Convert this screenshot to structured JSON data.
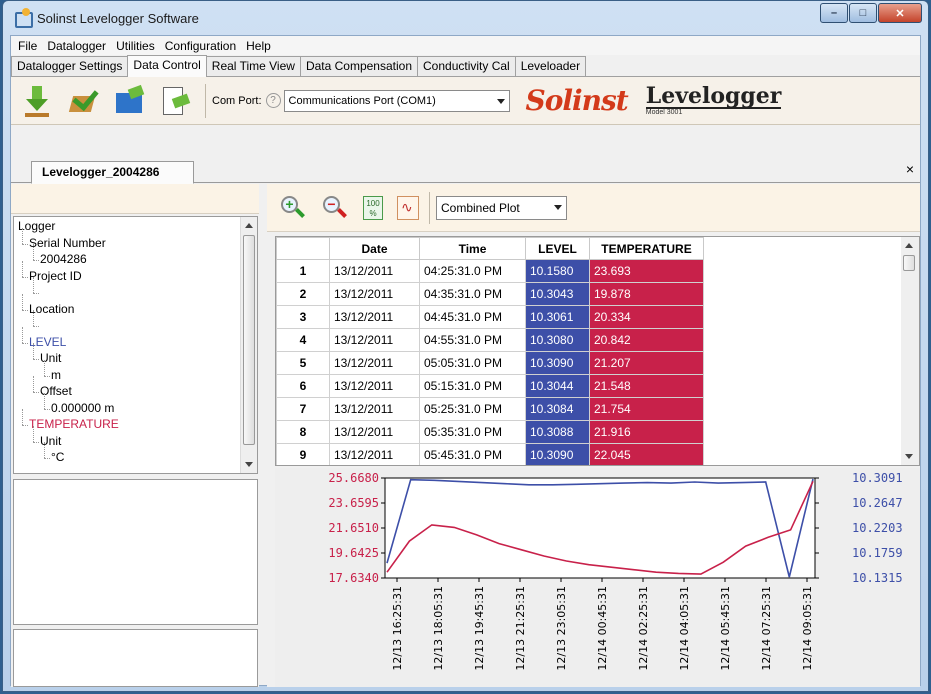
{
  "window": {
    "title": "Solinst Levelogger Software"
  },
  "menu": [
    "File",
    "Datalogger",
    "Utilities",
    "Configuration",
    "Help"
  ],
  "tabs": [
    "Datalogger Settings",
    "Data Control",
    "Real Time View",
    "Data Compensation",
    "Conductivity Cal",
    "Leveloader"
  ],
  "active_tab": "Data Control",
  "toolbar": {
    "com_port_label": "Com Port:",
    "com_port_value": "Communications Port (COM1)",
    "logo_solinst": "Solinst",
    "logo_levelogger": "Levelogger",
    "logo_model": "Model 3001"
  },
  "doc_tab": {
    "label": "Levelogger_2004286",
    "close": "×"
  },
  "tree": [
    {
      "label": "Logger",
      "indent": 0,
      "color": "#000000"
    },
    {
      "label": "Serial Number",
      "indent": 1,
      "color": "#000000"
    },
    {
      "label": "2004286",
      "indent": 2,
      "color": "#000000"
    },
    {
      "label": "Project ID",
      "indent": 1,
      "color": "#000000"
    },
    {
      "label": "",
      "indent": 2,
      "color": "#000000"
    },
    {
      "label": "Location",
      "indent": 1,
      "color": "#000000"
    },
    {
      "label": "",
      "indent": 2,
      "color": "#000000"
    },
    {
      "label": "LEVEL",
      "indent": 1,
      "color": "#3d4fa8"
    },
    {
      "label": "Unit",
      "indent": 2,
      "color": "#000000"
    },
    {
      "label": "m",
      "indent": 3,
      "color": "#000000"
    },
    {
      "label": "Offset",
      "indent": 2,
      "color": "#000000"
    },
    {
      "label": "0.000000 m",
      "indent": 3,
      "color": "#000000"
    },
    {
      "label": "TEMPERATURE",
      "indent": 1,
      "color": "#c8214a"
    },
    {
      "label": "Unit",
      "indent": 2,
      "color": "#000000"
    },
    {
      "label": "°C",
      "indent": 3,
      "color": "#000000"
    }
  ],
  "plot_toolbar": {
    "plot_mode": "Combined Plot",
    "pct_icon_text": "100 %"
  },
  "grid": {
    "headers": [
      "",
      "Date",
      "Time",
      "LEVEL",
      "TEMPERATURE"
    ],
    "rows": [
      [
        "1",
        "13/12/2011",
        "04:25:31.0 PM",
        "10.1580",
        "23.693"
      ],
      [
        "2",
        "13/12/2011",
        "04:35:31.0 PM",
        "10.3043",
        "19.878"
      ],
      [
        "3",
        "13/12/2011",
        "04:45:31.0 PM",
        "10.3061",
        "20.334"
      ],
      [
        "4",
        "13/12/2011",
        "04:55:31.0 PM",
        "10.3080",
        "20.842"
      ],
      [
        "5",
        "13/12/2011",
        "05:05:31.0 PM",
        "10.3090",
        "21.207"
      ],
      [
        "6",
        "13/12/2011",
        "05:15:31.0 PM",
        "10.3044",
        "21.548"
      ],
      [
        "7",
        "13/12/2011",
        "05:25:31.0 PM",
        "10.3084",
        "21.754"
      ],
      [
        "8",
        "13/12/2011",
        "05:35:31.0 PM",
        "10.3088",
        "21.916"
      ],
      [
        "9",
        "13/12/2011",
        "05:45:31.0 PM",
        "10.3090",
        "22.045"
      ]
    ]
  },
  "colors": {
    "level": "#3d4fa8",
    "temperature": "#c8214a"
  },
  "chart_data": {
    "type": "line",
    "x": [
      "12/13 16:25:31",
      "12/13 18:05:31",
      "12/13 19:45:31",
      "12/13 21:25:31",
      "12/13 23:05:31",
      "12/14 00:45:31",
      "12/14 02:25:31",
      "12/14 04:05:31",
      "12/14 05:45:31",
      "12/14 07:25:31",
      "12/14 09:05:31"
    ],
    "left_ticks": [
      "25.6680",
      "23.6595",
      "21.6510",
      "19.6425",
      "17.6340"
    ],
    "right_ticks": [
      "10.3091",
      "10.2647",
      "10.2203",
      "10.1759",
      "10.1315"
    ],
    "ylim_left": [
      17.634,
      25.668
    ],
    "ylim_right": [
      10.1315,
      10.3091
    ],
    "series": [
      {
        "name": "LEVEL",
        "axis": "right",
        "values": [
          10.158,
          10.306,
          10.305,
          10.303,
          10.301,
          10.299,
          10.297,
          10.297,
          10.298,
          10.299,
          10.3,
          10.301,
          10.3,
          10.302,
          10.3,
          10.301,
          10.302,
          10.1315,
          10.3091
        ]
      },
      {
        "name": "TEMPERATURE",
        "axis": "left",
        "values": [
          18.1,
          20.6,
          21.9,
          21.7,
          21.1,
          20.4,
          19.9,
          19.4,
          19.0,
          18.7,
          18.5,
          18.3,
          18.1,
          18.0,
          17.95,
          18.9,
          20.2,
          20.9,
          21.5,
          25.4
        ]
      }
    ],
    "grid": false
  }
}
